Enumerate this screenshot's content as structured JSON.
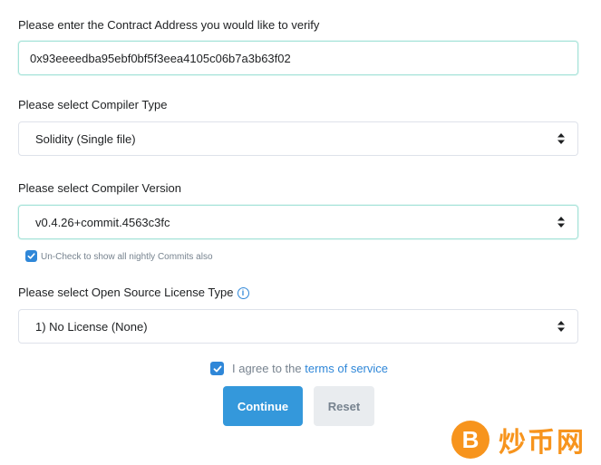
{
  "address": {
    "label": "Please enter the Contract Address you would like to verify",
    "value": "0x93eeeedba95ebf0bf5f3eea4105c06b7a3b63f02"
  },
  "compiler_type": {
    "label": "Please select Compiler Type",
    "selected": "Solidity (Single file)"
  },
  "compiler_version": {
    "label": "Please select Compiler Version",
    "selected": "v0.4.26+commit.4563c3fc",
    "nightly_checkbox_label": "Un-Check to show all nightly Commits also"
  },
  "license": {
    "label": "Please select Open Source License Type",
    "info_glyph": "i",
    "selected": "1) No License (None)"
  },
  "terms": {
    "prefix": "I agree to the",
    "link_text": "terms of service"
  },
  "buttons": {
    "continue": "Continue",
    "reset": "Reset"
  },
  "watermark": {
    "coin_glyph": "B",
    "text": "炒币网"
  },
  "colors": {
    "accent": "#3498db",
    "focus_border": "#a6e3d9",
    "watermark": "#f7941d"
  }
}
